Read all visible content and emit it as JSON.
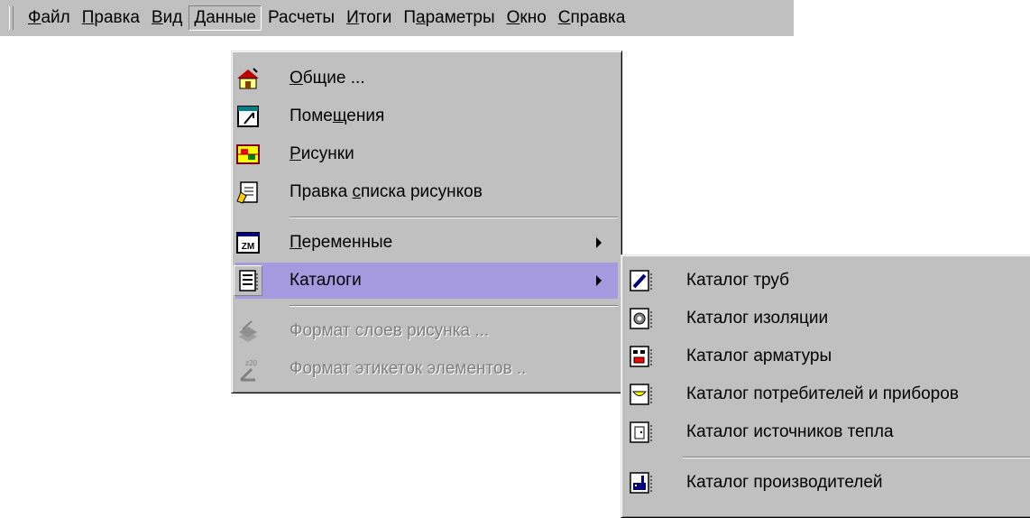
{
  "menubar": {
    "items": [
      {
        "label": "Файл",
        "accel": "Ф",
        "rest": "айл"
      },
      {
        "label": "Правка",
        "accel": "П",
        "rest": "равка"
      },
      {
        "label": "Вид",
        "accel": "В",
        "rest": "ид"
      },
      {
        "label": "Данные",
        "accel": "Д",
        "rest": "анные"
      },
      {
        "label": "Расчеты",
        "accel": "",
        "rest": "Расчеты"
      },
      {
        "label": "Итоги",
        "accel": "И",
        "rest": "тоги"
      },
      {
        "label": "Параметры",
        "pre": "П",
        "accel": "а",
        "rest": "раметры"
      },
      {
        "label": "Окно",
        "accel": "О",
        "rest": "кно"
      },
      {
        "label": "Справка",
        "accel": "С",
        "rest": "правка"
      }
    ]
  },
  "data_menu": {
    "items": [
      {
        "pre": "",
        "accel": "О",
        "rest": "бщие ...",
        "icon": "house-icon"
      },
      {
        "pre": "Поме",
        "accel": "щ",
        "rest": "ения",
        "icon": "room-plan-icon"
      },
      {
        "pre": "",
        "accel": "Р",
        "rest": "исунки",
        "icon": "drawings-icon"
      },
      {
        "pre": "Правка ",
        "accel": "с",
        "rest": "писка рисунков",
        "icon": "edit-list-icon"
      },
      {
        "pre": "",
        "accel": "П",
        "rest": "еременные",
        "icon": "variables-icon",
        "icon_text": "ZM"
      },
      {
        "pre": "",
        "accel": "",
        "rest": "Каталоги",
        "icon": "catalogs-icon"
      },
      {
        "pre": "",
        "accel": "",
        "rest": "Формат слоев рисунка ...",
        "icon": "layers-format-icon"
      },
      {
        "pre": "",
        "accel": "",
        "rest": "Формат этикеток элементов ..",
        "icon": "labels-format-icon"
      }
    ]
  },
  "catalogs_submenu": {
    "items": [
      {
        "label": "Каталог труб",
        "icon": "pipe-catalog-icon"
      },
      {
        "label": "Каталог изоляции",
        "icon": "insulation-catalog-icon"
      },
      {
        "label": "Каталог арматуры",
        "icon": "valves-catalog-icon"
      },
      {
        "label": "Каталог потребителей и приборов",
        "icon": "consumers-catalog-icon"
      },
      {
        "label": "Каталог источников тепла",
        "icon": "heat-sources-catalog-icon"
      },
      {
        "label": "Каталог производителей",
        "icon": "manufacturers-catalog-icon"
      }
    ]
  },
  "colors": {
    "menu_bg": "#c0c0c0",
    "highlight": "#a59ae0"
  }
}
